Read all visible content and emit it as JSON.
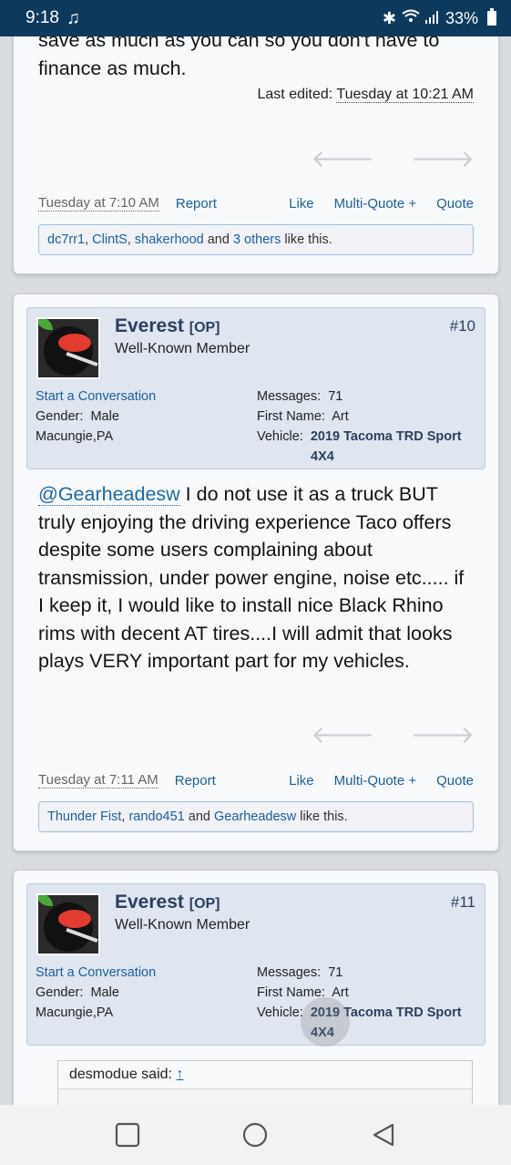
{
  "status": {
    "time": "9:18",
    "battery": "33%",
    "icons": [
      "music-note-icon",
      "bluetooth-icon",
      "wifi-icon",
      "signal-icon",
      "battery-icon"
    ]
  },
  "post1": {
    "text_tail_1": "save as much as you can so you don't have to",
    "text_tail_2": "finance as much.",
    "edited_label": "Last edited:",
    "edited_date": "Tuesday at 10:21 AM",
    "date": "Tuesday at 7:10 AM",
    "report": "Report",
    "like": "Like",
    "multiquote": "Multi-Quote +",
    "quote": "Quote",
    "likes": {
      "u1": "dc7rr1",
      "sep1": ", ",
      "u2": "ClintS",
      "sep2": ", ",
      "u3": "shakerhood",
      "and": " and ",
      "others": "3 others",
      "suffix": " like this."
    }
  },
  "post2": {
    "user": {
      "name": "Everest",
      "op": "[OP]",
      "title": "Well-Known Member",
      "post_number": "#10",
      "start_conversation": "Start a Conversation",
      "gender_label": "Gender:",
      "gender": "Male",
      "location": "Macungie,PA",
      "messages_label": "Messages:",
      "messages": "71",
      "firstname_label": "First Name:",
      "firstname": "Art",
      "vehicle_label": "Vehicle:",
      "vehicle_1": "2019 Tacoma TRD Sport",
      "vehicle_2": "4X4"
    },
    "mention": "@Gearheadesw",
    "line1": " I do not use it as a truck BUT",
    "line2": "truly enjoying the driving experience Taco offers",
    "line3": "despite some users complaining about",
    "line4": "transmission, under power engine, noise etc..... if",
    "line5": "I keep it, I would like to install nice Black Rhino",
    "line6": "rims with decent AT tires....I will admit that looks",
    "line7": "plays VERY important part for my vehicles.",
    "date": "Tuesday at 7:11 AM",
    "report": "Report",
    "like": "Like",
    "multiquote": "Multi-Quote +",
    "quote": "Quote",
    "likes": {
      "u1": "Thunder Fist",
      "sep1": ", ",
      "u2": "rando451",
      "and": " and ",
      "u3": "Gearheadesw",
      "suffix": " like this."
    }
  },
  "post3": {
    "user": {
      "name": "Everest",
      "op": "[OP]",
      "title": "Well-Known Member",
      "post_number": "#11",
      "start_conversation": "Start a Conversation",
      "gender_label": "Gender:",
      "gender": "Male",
      "location": "Macungie,PA",
      "messages_label": "Messages:",
      "messages": "71",
      "firstname_label": "First Name:",
      "firstname": "Art",
      "vehicle_label": "Vehicle:",
      "vehicle_1": "2019 Tacoma TRD Sport",
      "vehicle_2": "4X4"
    },
    "quote_author": "desmodue said:",
    "quote_up": "↑"
  }
}
